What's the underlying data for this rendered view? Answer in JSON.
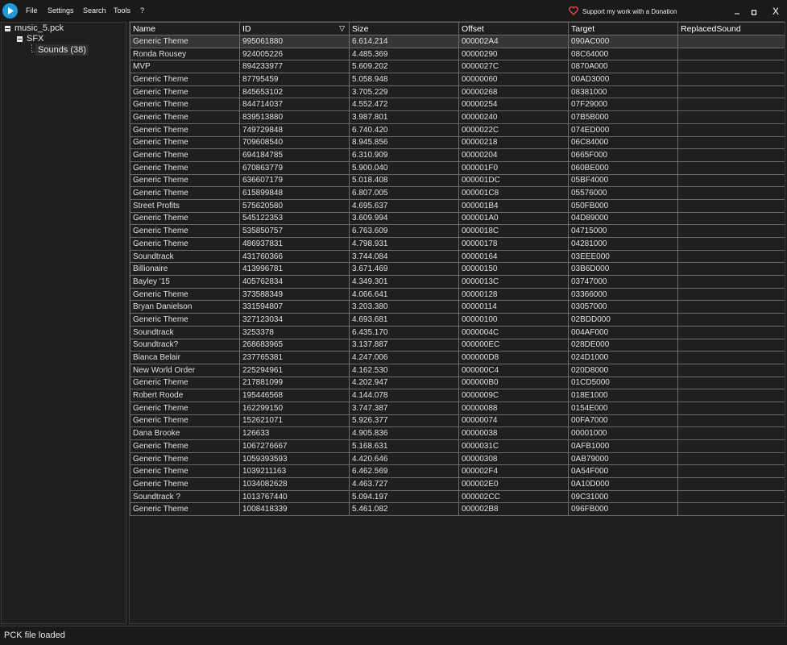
{
  "menu": {
    "file": "File",
    "settings": "Settings",
    "search": "Search",
    "tools": "Tools",
    "help": "?"
  },
  "donate_label": "Support my work with a Donation",
  "window": {
    "minimize": "_",
    "maximize": "□",
    "close": "X"
  },
  "tree": {
    "root": "music_5.pck",
    "sfx": "SFX",
    "sounds": "Sounds (38)"
  },
  "table": {
    "columns": [
      "Name",
      "ID",
      "Size",
      "Offset",
      "Target",
      "ReplacedSound"
    ],
    "rows": [
      [
        "Generic Theme",
        "995061880",
        "6.614.214",
        "000002A4",
        "090AC000",
        ""
      ],
      [
        "Ronda Rousey",
        "924005226",
        "4.485.369",
        "00000290",
        "08C64000",
        ""
      ],
      [
        "MVP",
        "894233977",
        "5.609.202",
        "0000027C",
        "0870A000",
        ""
      ],
      [
        "Generic Theme",
        "87795459",
        "5.058.948",
        "00000060",
        "00AD3000",
        ""
      ],
      [
        "Generic Theme",
        "845653102",
        "3.705.229",
        "00000268",
        "08381000",
        ""
      ],
      [
        "Generic Theme",
        "844714037",
        "4.552.472",
        "00000254",
        "07F29000",
        ""
      ],
      [
        "Generic Theme",
        "839513880",
        "3.987.801",
        "00000240",
        "07B5B000",
        ""
      ],
      [
        "Generic Theme",
        "749729848",
        "6.740.420",
        "0000022C",
        "074ED000",
        ""
      ],
      [
        "Generic Theme",
        "709608540",
        "8.945.856",
        "00000218",
        "06C84000",
        ""
      ],
      [
        "Generic Theme",
        "694184785",
        "6.310.909",
        "00000204",
        "0665F000",
        ""
      ],
      [
        "Generic Theme",
        "670863779",
        "5.900.040",
        "000001F0",
        "060BE000",
        ""
      ],
      [
        "Generic Theme",
        "636607179",
        "5.018.408",
        "000001DC",
        "05BF4000",
        ""
      ],
      [
        "Generic Theme",
        "615899848",
        "6.807.005",
        "000001C8",
        "05576000",
        ""
      ],
      [
        "Street Profits",
        "575620580",
        "4.695.637",
        "000001B4",
        "050FB000",
        ""
      ],
      [
        "Generic Theme",
        "545122353",
        "3.609.994",
        "000001A0",
        "04D89000",
        ""
      ],
      [
        "Generic Theme",
        "535850757",
        "6.763.609",
        "0000018C",
        "04715000",
        ""
      ],
      [
        "Generic Theme",
        "486937831",
        "4.798.931",
        "00000178",
        "04281000",
        ""
      ],
      [
        "Soundtrack",
        "431760366",
        "3.744.084",
        "00000164",
        "03EEE000",
        ""
      ],
      [
        "Billionaire",
        "413996781",
        "3.671.469",
        "00000150",
        "03B6D000",
        ""
      ],
      [
        "Bayley '15",
        "405762834",
        "4.349.301",
        "0000013C",
        "03747000",
        ""
      ],
      [
        "Generic Theme",
        "373588349",
        "4.066.641",
        "00000128",
        "03366000",
        ""
      ],
      [
        "Bryan Danielson",
        "331594807",
        "3.203.380",
        "00000114",
        "03057000",
        ""
      ],
      [
        "Generic Theme",
        "327123034",
        "4.693.681",
        "00000100",
        "02BDD000",
        ""
      ],
      [
        "Soundtrack",
        "3253378",
        "6.435.170",
        "0000004C",
        "004AF000",
        ""
      ],
      [
        "Soundtrack?",
        "268683965",
        "3.137.887",
        "000000EC",
        "028DE000",
        ""
      ],
      [
        "Bianca Belair",
        "237765381",
        "4.247.006",
        "000000D8",
        "024D1000",
        ""
      ],
      [
        "New World Order",
        "225294961",
        "4.162.530",
        "000000C4",
        "020D8000",
        ""
      ],
      [
        "Generic Theme",
        "217881099",
        "4.202.947",
        "000000B0",
        "01CD5000",
        ""
      ],
      [
        "Robert Roode",
        "195446568",
        "4.144.078",
        "0000009C",
        "018E1000",
        ""
      ],
      [
        "Generic Theme",
        "162299150",
        "3.747.387",
        "00000088",
        "0154E000",
        ""
      ],
      [
        "Generic Theme",
        "152621071",
        "5.926.377",
        "00000074",
        "00FA7000",
        ""
      ],
      [
        "Dana Brooke",
        "126633",
        "4.905.836",
        "00000038",
        "00001000",
        ""
      ],
      [
        "Generic Theme",
        "1067276667",
        "5.168.631",
        "0000031C",
        "0AFB1000",
        ""
      ],
      [
        "Generic Theme",
        "1059393593",
        "4.420.646",
        "00000308",
        "0AB79000",
        ""
      ],
      [
        "Generic Theme",
        "1039211163",
        "6.462.569",
        "000002F4",
        "0A54F000",
        ""
      ],
      [
        "Generic Theme",
        "1034082628",
        "4.463.727",
        "000002E0",
        "0A10D000",
        ""
      ],
      [
        "Soundtrack ?",
        "1013767440",
        "5.094.197",
        "000002CC",
        "09C31000",
        ""
      ],
      [
        "Generic Theme",
        "1008418339",
        "5.461.082",
        "000002B8",
        "096FB000",
        ""
      ]
    ]
  },
  "status": "PCK file loaded",
  "colors": {
    "background": "#1f1f1f",
    "accent": "#1e9bd7",
    "heart": "#e04848",
    "selected_row": "#363636"
  }
}
